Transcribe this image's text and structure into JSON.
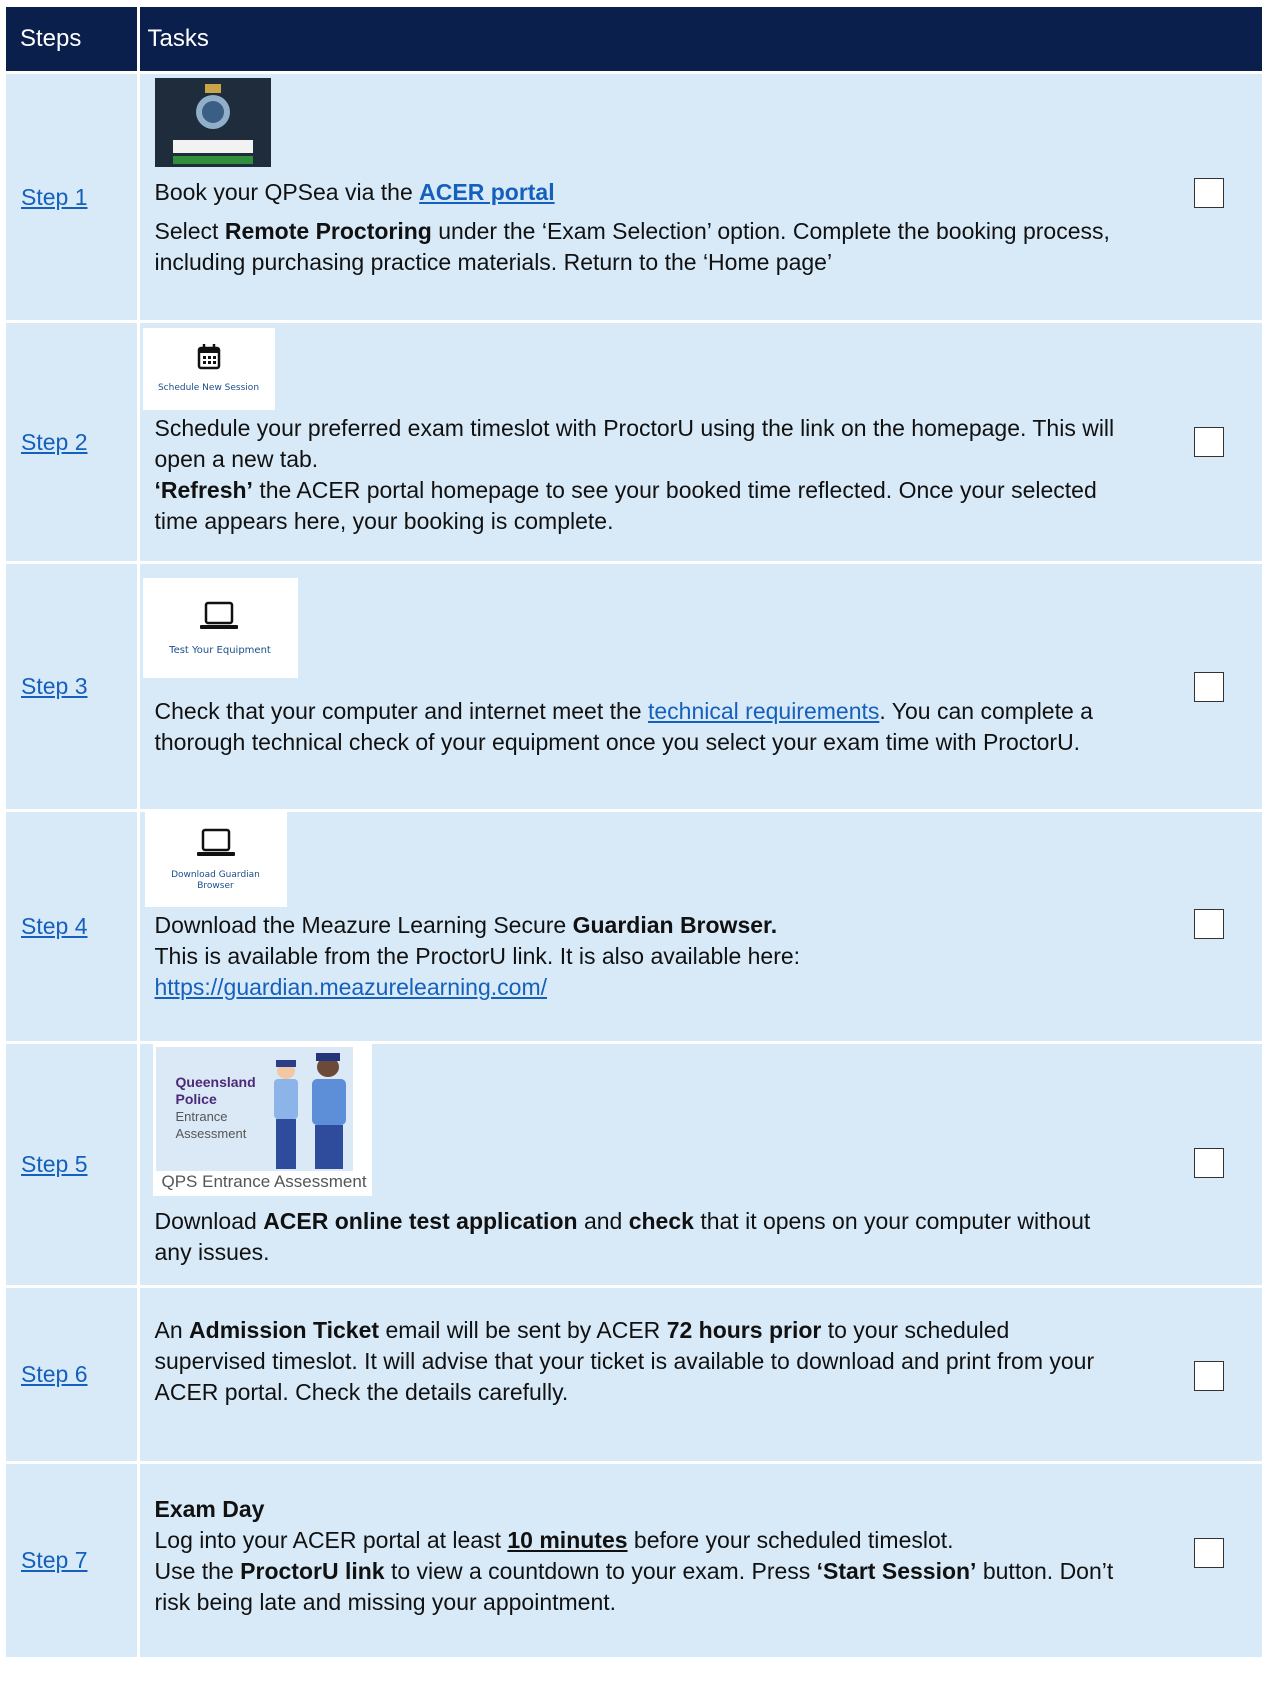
{
  "header": {
    "col1": "Steps",
    "col2": "Tasks"
  },
  "rows": [
    {
      "step": "Step 1",
      "image": {
        "type": "qps-logo-login"
      },
      "lines": [
        {
          "parts": [
            {
              "t": "Book your QPSea via the "
            },
            {
              "t": "ACER portal",
              "b": true,
              "link": true
            }
          ]
        },
        {
          "gap": true,
          "parts": [
            {
              "t": "Select "
            },
            {
              "t": "Remote Proctoring",
              "b": true
            },
            {
              "t": " under the ‘Exam Selection’ option.  Complete the booking process, including purchasing practice materials. Return to the ‘Home page’"
            }
          ]
        }
      ]
    },
    {
      "step": "Step 2",
      "image": {
        "type": "calendar",
        "caption": "Schedule New Session"
      },
      "lines": [
        {
          "parts": [
            {
              "t": "Schedule your preferred exam timeslot with ProctorU using the link on the homepage. This will open a new tab."
            }
          ]
        },
        {
          "parts": [
            {
              "t": "‘Refresh’",
              "b": true
            },
            {
              "t": " the ACER portal homepage to see your booked time reflected. Once your selected time appears here, your booking is complete."
            }
          ]
        }
      ]
    },
    {
      "step": "Step 3",
      "image": {
        "type": "laptop",
        "caption": "Test Your Equipment"
      },
      "lines": [
        {
          "parts": [
            {
              "t": "Check that your computer and internet meet the "
            },
            {
              "t": "technical requirements",
              "link": true
            },
            {
              "t": ". You can complete a thorough technical check of your equipment once you select your exam time with ProctorU."
            }
          ]
        }
      ]
    },
    {
      "step": "Step 4",
      "image": {
        "type": "laptop",
        "caption": "Download Guardian Browser"
      },
      "lines": [
        {
          "parts": [
            {
              "t": "Download the Meazure Learning Secure "
            },
            {
              "t": "Guardian Browser.",
              "b": true
            }
          ]
        },
        {
          "parts": [
            {
              "t": "This is available from the ProctorU link. It is also available here: "
            },
            {
              "t": "https://guardian.meazurelearning.com/",
              "link": true
            }
          ]
        }
      ]
    },
    {
      "step": "Step 5",
      "image": {
        "type": "qps-poster",
        "title1": "Queensland",
        "title2": "Police",
        "sub1": "Entrance",
        "sub2": "Assessment",
        "caption": "QPS Entrance Assessment"
      },
      "lines": [
        {
          "parts": [
            {
              "t": "Download "
            },
            {
              "t": "ACER online test application",
              "b": true
            },
            {
              "t": " and "
            },
            {
              "t": "check",
              "b": true
            },
            {
              "t": " that it opens on your computer without any issues."
            }
          ]
        }
      ]
    },
    {
      "step": "Step 6",
      "lines": [
        {
          "parts": [
            {
              "t": "An "
            },
            {
              "t": "Admission Ticket",
              "b": true
            },
            {
              "t": " email will be sent by ACER "
            },
            {
              "t": "72 hours prior",
              "b": true
            },
            {
              "t": " to your scheduled supervised timeslot.  It will advise that your ticket is available to download and print from your ACER portal. Check the details carefully."
            }
          ]
        }
      ]
    },
    {
      "step": "Step 7",
      "lines": [
        {
          "parts": [
            {
              "t": "Exam Day",
              "b": true
            }
          ]
        },
        {
          "parts": [
            {
              "t": "Log into your ACER portal at least "
            },
            {
              "t": "10 minutes",
              "b": true,
              "u": true
            },
            {
              "t": " before your scheduled timeslot."
            }
          ]
        },
        {
          "parts": [
            {
              "t": "Use the "
            },
            {
              "t": "ProctorU link",
              "b": true
            },
            {
              "t": " to view a countdown to your exam. Press "
            },
            {
              "t": "‘Start Session’",
              "b": true
            },
            {
              "t": " button. Don’t risk being late and missing your appointment."
            }
          ]
        }
      ]
    }
  ]
}
